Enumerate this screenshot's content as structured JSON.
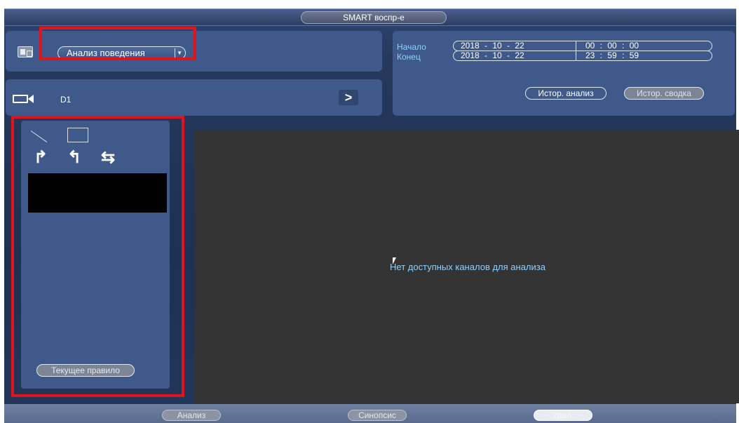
{
  "window": {
    "title": "SMART воспр-е"
  },
  "mode": {
    "selected": "Анализ поведения",
    "arrow_icon": "chevron-down-icon"
  },
  "channel": {
    "name": "D1",
    "next_label": ">"
  },
  "time": {
    "start_label": "Начало",
    "end_label": "Конец",
    "start_date": "2018 - 10 - 22",
    "start_time": "00 : 00 : 00",
    "end_date": "2018 - 10 - 22",
    "end_time": "23 : 59 : 59"
  },
  "history": {
    "analysis_label": "Истор. анализ",
    "summary_label": "Истор. сводка"
  },
  "rules": {
    "direction_icons": [
      "↱",
      "↰",
      "⇆"
    ],
    "current_rule_label": "Текущее правило"
  },
  "video": {
    "empty_message": "Нет доступных каналов для анализа"
  },
  "bottom": {
    "analysis_label": "Анализ",
    "synopsis_label": "Синопсис",
    "delete_label": "Удал."
  },
  "colors": {
    "highlight": "#e0141c",
    "accent_text": "#8fd0ff",
    "panel": "#3f5a8a"
  }
}
